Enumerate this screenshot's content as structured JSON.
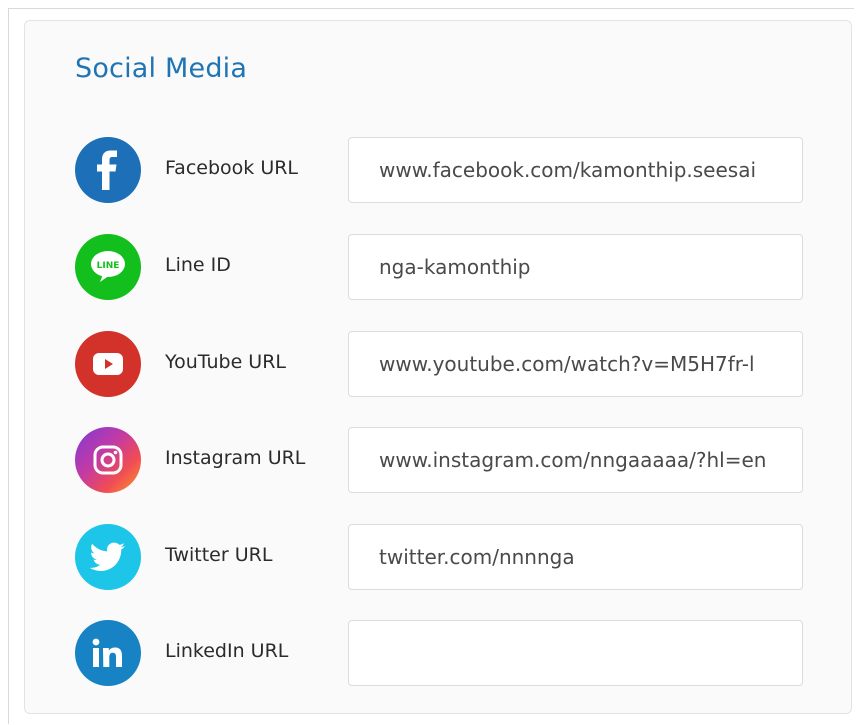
{
  "section": {
    "title": "Social Media"
  },
  "colors": {
    "title": "#1f74b4",
    "facebook": "#1d6fb8",
    "line": "#13bf1c",
    "youtube": "#d3322a",
    "twitter": "#1dc5e8",
    "linkedin": "#1782c4"
  },
  "rows": [
    {
      "icon": "facebook-icon",
      "label": "Facebook URL",
      "value": "www.facebook.com/kamonthip.seesai"
    },
    {
      "icon": "line-icon",
      "label": "Line ID",
      "value": "nga-kamonthip"
    },
    {
      "icon": "youtube-icon",
      "label": "YouTube URL",
      "value": "www.youtube.com/watch?v=M5H7fr-l"
    },
    {
      "icon": "instagram-icon",
      "label": "Instagram URL",
      "value": "www.instagram.com/nngaaaaa/?hl=en"
    },
    {
      "icon": "twitter-icon",
      "label": "Twitter URL",
      "value": "twitter.com/nnnnga"
    },
    {
      "icon": "linkedin-icon",
      "label": "LinkedIn URL",
      "value": ""
    }
  ],
  "line_icon_text": "LINE"
}
